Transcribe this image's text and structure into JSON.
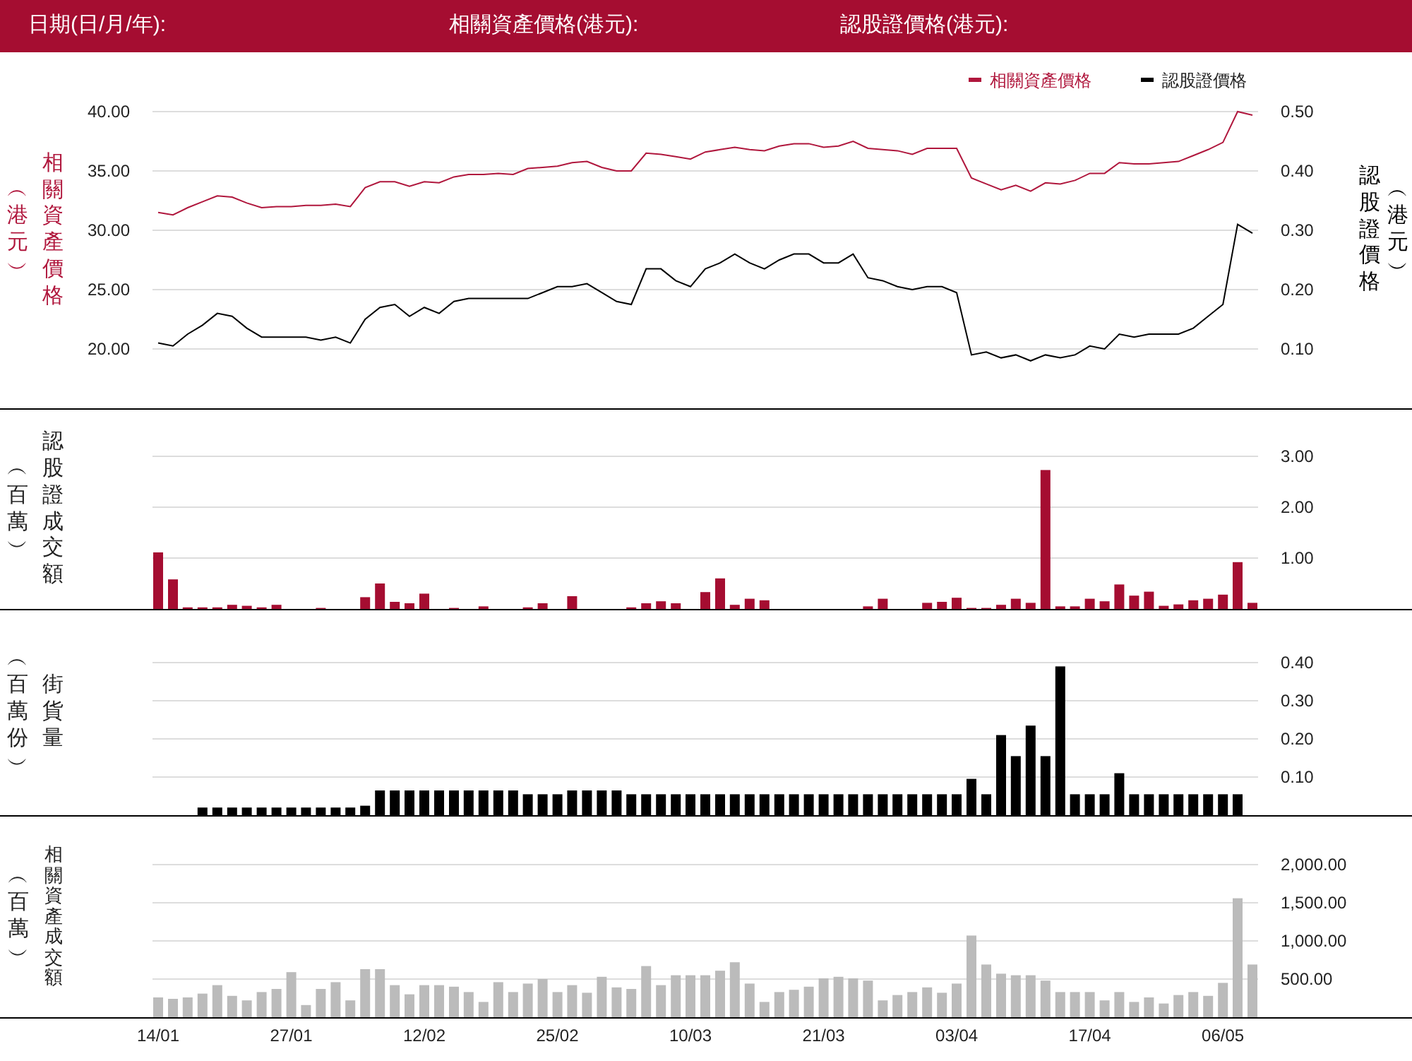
{
  "header": {
    "fields": [
      "日期(日/月/年):",
      "相關資產價格(港元):",
      "認股證價格(港元):"
    ]
  },
  "charts": [
    {
      "yunit": "︵港元︶",
      "ylabel_right": "認股證價格",
      "yunit_right": "︵港元︶",
      "chart_data": {
        "type": "line",
        "ylabel": "相關資產價格",
        "grid": true,
        "legend": "top-right",
        "ylim": [
          15,
          40
        ],
        "y2lim": [
          0,
          0.5
        ],
        "yticks": [
          {
            "value": 40,
            "label": "40.00"
          },
          {
            "value": 35,
            "label": "35.00"
          },
          {
            "value": 30,
            "label": "30.00"
          },
          {
            "value": 25,
            "label": "25.00"
          },
          {
            "value": 20,
            "label": "20.00"
          }
        ],
        "y2ticks": [
          {
            "value": 0.5,
            "label": "0.50"
          },
          {
            "value": 0.4,
            "label": "0.40"
          },
          {
            "value": 0.3,
            "label": "0.30"
          },
          {
            "value": 0.2,
            "label": "0.20"
          },
          {
            "value": 0.1,
            "label": "0.10"
          }
        ],
        "series": [
          {
            "name": "相關資產價格",
            "color": "#b0173d",
            "values": [
              31.5,
              31.3,
              31.9,
              32.4,
              32.9,
              32.8,
              32.3,
              31.9,
              32.0,
              32.0,
              32.1,
              32.1,
              32.2,
              32.0,
              33.6,
              34.1,
              34.1,
              33.7,
              34.1,
              34.0,
              34.5,
              34.7,
              34.7,
              34.8,
              34.7,
              35.2,
              35.3,
              35.4,
              35.7,
              35.8,
              35.3,
              35.0,
              35.0,
              36.5,
              36.4,
              36.2,
              36.0,
              36.6,
              36.8,
              37.0,
              36.8,
              36.7,
              37.1,
              37.3,
              37.3,
              37.0,
              37.1,
              37.5,
              36.9,
              36.8,
              36.7,
              36.4,
              36.9,
              36.9,
              36.9,
              34.4,
              33.9,
              33.4,
              33.8,
              33.3,
              34.0,
              33.9,
              34.2,
              34.8,
              34.8,
              35.7,
              35.6,
              35.6,
              35.7,
              35.8,
              36.3,
              36.8,
              37.4,
              40.0,
              39.7
            ]
          },
          {
            "name": "認股證價格",
            "color": "#000000",
            "axis": "y2",
            "values": [
              0.11,
              0.105,
              0.125,
              0.14,
              0.16,
              0.155,
              0.135,
              0.12,
              0.12,
              0.12,
              0.12,
              0.115,
              0.12,
              0.11,
              0.15,
              0.17,
              0.175,
              0.155,
              0.17,
              0.16,
              0.18,
              0.185,
              0.185,
              0.185,
              0.185,
              0.185,
              0.195,
              0.205,
              0.205,
              0.21,
              0.195,
              0.18,
              0.175,
              0.235,
              0.235,
              0.215,
              0.205,
              0.235,
              0.245,
              0.26,
              0.245,
              0.235,
              0.25,
              0.26,
              0.26,
              0.245,
              0.245,
              0.26,
              0.22,
              0.215,
              0.205,
              0.2,
              0.205,
              0.205,
              0.195,
              0.09,
              0.095,
              0.085,
              0.09,
              0.08,
              0.09,
              0.085,
              0.09,
              0.105,
              0.1,
              0.125,
              0.12,
              0.125,
              0.125,
              0.125,
              0.135,
              0.155,
              0.175,
              0.31,
              0.295
            ]
          }
        ]
      }
    },
    {
      "yunit": "︵百萬︶",
      "chart_data": {
        "type": "bar",
        "ylabel": "認股證成交額",
        "grid": true,
        "ylim": [
          0,
          3
        ],
        "yticks": [
          {
            "value": 3,
            "label": "3.00"
          },
          {
            "value": 2,
            "label": "2.00"
          },
          {
            "value": 1,
            "label": "1.00"
          }
        ],
        "series": [
          {
            "color": "#a50d31",
            "values": [
              1.11,
              0.58,
              0.03,
              0.03,
              0.03,
              0.08,
              0.06,
              0.03,
              0.08,
              null,
              null,
              0.02,
              null,
              null,
              0.23,
              0.5,
              0.14,
              0.11,
              0.3,
              null,
              0.02,
              null,
              0.05,
              null,
              null,
              0.03,
              0.11,
              null,
              0.25,
              null,
              null,
              null,
              0.03,
              0.11,
              0.15,
              0.11,
              null,
              0.33,
              0.6,
              0.08,
              0.2,
              0.17,
              null,
              null,
              null,
              null,
              null,
              null,
              0.05,
              0.2,
              null,
              null,
              0.12,
              0.14,
              0.22,
              0.02,
              0.02,
              0.08,
              0.2,
              0.12,
              2.73,
              0.05,
              0.05,
              0.2,
              0.15,
              0.48,
              0.26,
              0.34,
              0.06,
              0.09,
              0.17,
              0.2,
              0.28,
              0.92,
              0.12
            ]
          }
        ]
      }
    },
    {
      "yunit": "︵百萬份︶",
      "chart_data": {
        "type": "bar",
        "ylabel": "街貨量",
        "grid": true,
        "ylim": [
          0,
          0.4
        ],
        "yticks": [
          {
            "value": 0.4,
            "label": "0.40"
          },
          {
            "value": 0.3,
            "label": "0.30"
          },
          {
            "value": 0.2,
            "label": "0.20"
          },
          {
            "value": 0.1,
            "label": "0.10"
          }
        ],
        "series": [
          {
            "color": "#000000",
            "values": [
              null,
              null,
              null,
              0.02,
              0.02,
              0.02,
              0.02,
              0.02,
              0.02,
              0.02,
              0.02,
              0.02,
              0.02,
              0.02,
              0.025,
              0.065,
              0.065,
              0.065,
              0.065,
              0.065,
              0.065,
              0.065,
              0.065,
              0.065,
              0.065,
              0.055,
              0.055,
              0.055,
              0.065,
              0.065,
              0.065,
              0.065,
              0.055,
              0.055,
              0.055,
              0.055,
              0.055,
              0.055,
              0.055,
              0.055,
              0.055,
              0.055,
              0.055,
              0.055,
              0.055,
              0.055,
              0.055,
              0.055,
              0.055,
              0.055,
              0.055,
              0.055,
              0.055,
              0.055,
              0.055,
              0.095,
              0.055,
              0.21,
              0.155,
              0.235,
              0.155,
              0.39,
              0.055,
              0.055,
              0.055,
              0.11,
              0.055,
              0.055,
              0.055,
              0.055,
              0.055,
              0.055,
              0.055,
              0.055,
              null
            ]
          }
        ]
      }
    },
    {
      "yunit": "︵百萬︶",
      "chart_data": {
        "type": "bar",
        "ylabel": "相關資產成交額",
        "grid": true,
        "ylim": [
          0,
          2000
        ],
        "categories": [
          "14/01",
          null,
          null,
          null,
          null,
          null,
          null,
          null,
          null,
          "27/01",
          null,
          null,
          null,
          null,
          null,
          null,
          null,
          null,
          "12/02",
          null,
          null,
          null,
          null,
          null,
          null,
          null,
          null,
          "25/02",
          null,
          null,
          null,
          null,
          null,
          null,
          null,
          null,
          "10/03",
          null,
          null,
          null,
          null,
          null,
          null,
          null,
          null,
          "21/03",
          null,
          null,
          null,
          null,
          null,
          null,
          null,
          null,
          "03/04",
          null,
          null,
          null,
          null,
          null,
          null,
          null,
          null,
          "17/04",
          null,
          null,
          null,
          null,
          null,
          null,
          null,
          null,
          "06/05",
          null,
          null
        ],
        "yticks": [
          {
            "value": 2000,
            "label": "2,000.00"
          },
          {
            "value": 1500,
            "label": "1,500.00"
          },
          {
            "value": 1000,
            "label": "1,000.00"
          },
          {
            "value": 500,
            "label": "500.00"
          }
        ],
        "series": [
          {
            "color": "#bbbbbb",
            "values": [
              260,
              240,
              260,
              310,
              420,
              280,
              220,
              330,
              370,
              590,
              160,
              370,
              460,
              220,
              630,
              630,
              420,
              300,
              420,
              420,
              400,
              330,
              200,
              460,
              330,
              440,
              500,
              330,
              420,
              320,
              530,
              390,
              370,
              670,
              420,
              550,
              550,
              550,
              610,
              720,
              440,
              200,
              330,
              360,
              400,
              510,
              530,
              510,
              480,
              220,
              290,
              330,
              390,
              320,
              440,
              1070,
              690,
              570,
              550,
              550,
              480,
              330,
              330,
              330,
              220,
              330,
              200,
              260,
              180,
              290,
              330,
              280,
              450,
              1560,
              690
            ]
          }
        ]
      }
    }
  ]
}
